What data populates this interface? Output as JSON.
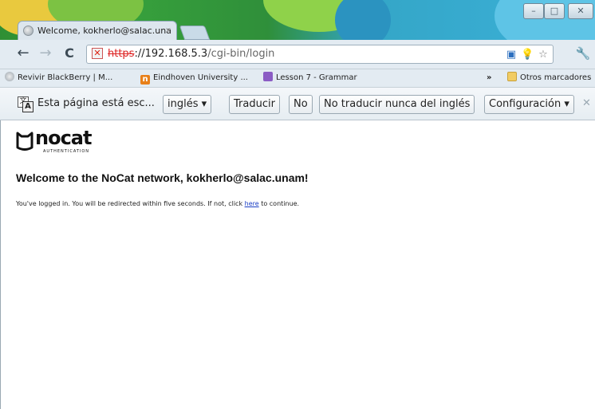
{
  "window": {
    "tab_title": "Welcome, kokherlo@salac.una",
    "tab_close": "×",
    "controls": {
      "minimize": "–",
      "maximize": "□",
      "close": "✕"
    }
  },
  "toolbar": {
    "back": "←",
    "forward": "→",
    "reload": "C",
    "url_scheme": "https",
    "url_host": "://192.168.5.3",
    "url_path": "/cgi-bin/login",
    "wrench": "🔧"
  },
  "bookmarks": {
    "items": [
      {
        "label": "Revivir BlackBerry | M...",
        "icon": "globe-icon"
      },
      {
        "label": "Eindhoven University ...",
        "icon": "n-logo-icon"
      },
      {
        "label": "Lesson 7 - Grammar",
        "icon": "book-icon"
      }
    ],
    "overflow": "»",
    "other": "Otros marcadores"
  },
  "translate": {
    "message": "Esta página está esc...",
    "language": "inglés ▾",
    "translate_button": "Traducir",
    "no_button": "No",
    "never_button": "No traducir nunca del inglés",
    "options_button": "Configuración ▾",
    "close": "✕"
  },
  "page": {
    "logo_text": "nocat",
    "logo_subtext": "AUTHENTICATION",
    "heading": "Welcome to the NoCat network, kokherlo@salac.unam!",
    "message_before": "You've logged in. You will be redirected within five seconds. If not, click ",
    "link_text": "here",
    "message_after": " to continue."
  },
  "colors": {
    "link": "#1a3ec4",
    "insecure_scheme": "#d22222"
  }
}
